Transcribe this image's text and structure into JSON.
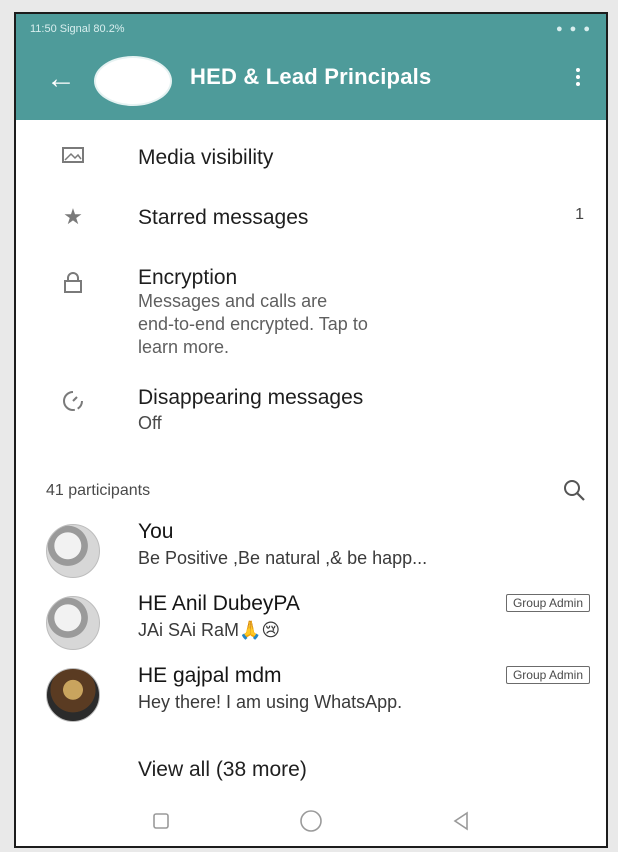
{
  "status_bar": {
    "left_text": "11:50 Signal 80.2%",
    "right_text": "● ● ●"
  },
  "header": {
    "back_icon": "back-arrow-icon",
    "title": "HED & Lead Principals",
    "menu_icon": "overflow-menu-icon",
    "colors": {
      "appbar": "#4e9b9a"
    }
  },
  "settings": [
    {
      "icon": "image-icon",
      "label": "Media visibility"
    },
    {
      "icon": "star-icon",
      "label": "Starred messages",
      "count": "1"
    },
    {
      "icon": "lock-icon",
      "label": "Encryption",
      "sub": [
        "Messages and calls are",
        "end-to-end encrypted. Tap to",
        "learn more."
      ]
    },
    {
      "icon": "timer-icon",
      "label": "Disappearing messages",
      "sub": [
        "Off"
      ]
    }
  ],
  "participants": {
    "header": "41 participants",
    "search_icon": "search-icon",
    "members": [
      {
        "name": "You",
        "status": "Be Positive ,Be natural ,& be happ..."
      },
      {
        "name": "HE Anil DubeyPA",
        "status": "JAi SAi RaM🙏😢",
        "badge": "Group Admin"
      },
      {
        "name": "HE gajpal mdm",
        "status": "Hey there! I am using WhatsApp.",
        "badge": "Group Admin"
      }
    ],
    "view_all": "View all (38 more)"
  },
  "navbar": {
    "icons": [
      "recents-square-icon",
      "home-circle-icon",
      "back-triangle-icon"
    ]
  }
}
